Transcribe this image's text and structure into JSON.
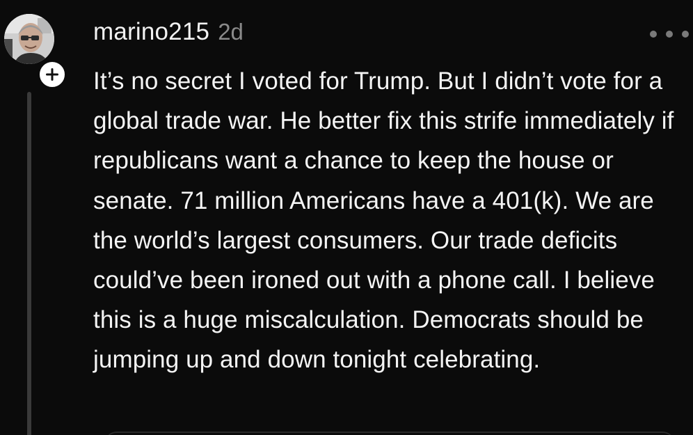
{
  "comment": {
    "author": {
      "username": "marino215",
      "timestamp": "2d",
      "avatar_icon": "user-avatar-photo",
      "follow_icon": "plus-icon"
    },
    "more_icon": "more-horizontal-icon",
    "body": "It’s no secret I voted for Trump. But I didn’t vote for a global trade war. He better fix this strife immediately if republicans want a chance to keep the house or senate. 71 million Americans have a 401(k). We are the world’s largest consumers. Our trade deficits could’ve been ironed out with a phone call. I believe this is a huge miscalculation. Democrats should be jumping up and down tonight celebrating."
  },
  "theme": {
    "background": "#0b0b0b",
    "text_primary": "#f4f4f4",
    "text_secondary": "#8a8a8a",
    "thread_line": "#3a3a3a"
  }
}
